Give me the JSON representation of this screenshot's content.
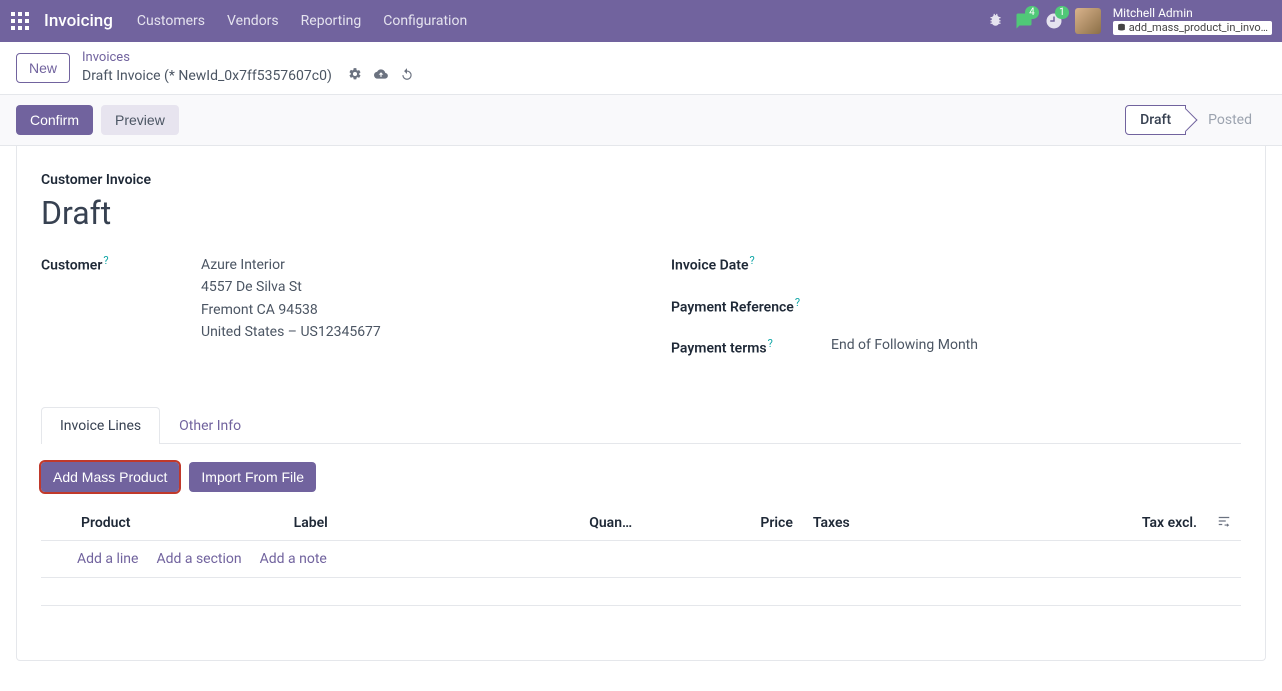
{
  "nav": {
    "brand": "Invoicing",
    "menu": [
      "Customers",
      "Vendors",
      "Reporting",
      "Configuration"
    ],
    "msg_count": "4",
    "activity_count": "1",
    "user": "Mitchell Admin",
    "db": "add_mass_product_in_invo…"
  },
  "bc": {
    "new": "New",
    "top": "Invoices",
    "title": "Draft Invoice (* NewId_0x7ff5357607c0)"
  },
  "actions": {
    "confirm": "Confirm",
    "preview": "Preview",
    "draft": "Draft",
    "posted": "Posted"
  },
  "form": {
    "head_label": "Customer Invoice",
    "title": "Draft",
    "customer_label": "Customer",
    "customer_name": "Azure Interior",
    "addr1": "4557 De Silva St",
    "addr2": "Fremont CA 94538",
    "addr3": "United States – US12345677",
    "invoice_date_label": "Invoice Date",
    "payment_ref_label": "Payment Reference",
    "payment_terms_label": "Payment terms",
    "payment_terms_val": "End of Following Month"
  },
  "tabs": {
    "lines": "Invoice Lines",
    "other": "Other Info"
  },
  "buttons": {
    "mass": "Add Mass Product",
    "import": "Import From File"
  },
  "cols": {
    "product": "Product",
    "label": "Label",
    "qty": "Quan…",
    "price": "Price",
    "taxes": "Taxes",
    "taxexcl": "Tax excl."
  },
  "line_actions": {
    "line": "Add a line",
    "section": "Add a section",
    "note": "Add a note"
  }
}
